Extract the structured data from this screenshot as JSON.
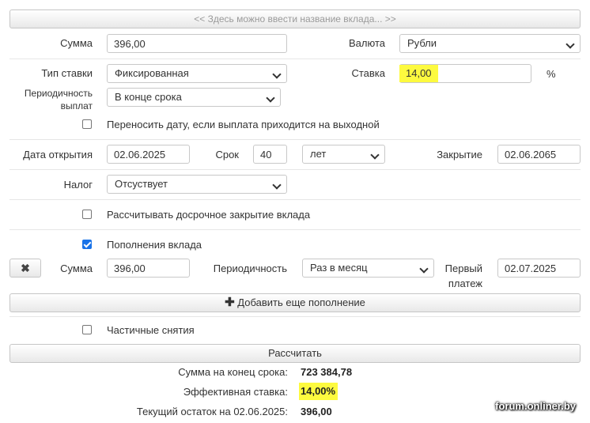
{
  "deposit_name_placeholder": "<< Здесь можно ввести название вклада... >>",
  "amount": {
    "label": "Сумма",
    "value": "396,00"
  },
  "currency": {
    "label": "Валюта",
    "selected": "Рубли"
  },
  "rate_type": {
    "label": "Тип ставки",
    "selected": "Фиксированная"
  },
  "rate": {
    "label": "Ставка",
    "value": "14,00",
    "unit": "%"
  },
  "payout_period": {
    "label_line1": "Периодичность",
    "label_line2": "выплат",
    "selected": "В конце срока"
  },
  "move_date": {
    "label": "Переносить дату, если выплата приходится на выходной",
    "checked": false
  },
  "open_date": {
    "label": "Дата открытия",
    "value": "02.06.2025"
  },
  "term": {
    "label": "Срок",
    "value": "40",
    "unit_selected": "лет"
  },
  "close_date": {
    "label": "Закрытие",
    "value": "02.06.2065"
  },
  "tax": {
    "label": "Налог",
    "selected": "Отсуствует"
  },
  "early_close": {
    "label": "Рассчитывать досрочное закрытие вклада",
    "checked": false
  },
  "replenishments": {
    "label": "Пополнения вклада",
    "checked": true,
    "item": {
      "remove_icon": "close-x-icon",
      "amount_label": "Сумма",
      "amount_value": "396,00",
      "period_label": "Периодичность",
      "period_selected": "Раз в месяц",
      "first_label_line1": "Первый",
      "first_label_line2": "платеж",
      "first_value": "02.07.2025"
    },
    "add_button": "Добавить еще пополнение"
  },
  "partial_withdrawals": {
    "label": "Частичные снятия",
    "checked": false
  },
  "calculate_button": "Рассчитать",
  "results": {
    "end_sum_label": "Сумма на конец срока:",
    "end_sum_value": "723 384,78",
    "effective_rate_label": "Эффективная ставка:",
    "effective_rate_value": "14,00%",
    "balance_label": "Текущий остаток на 02.06.2025:",
    "balance_value": "396,00"
  },
  "watermark": "forum.onliner.by",
  "colors": {
    "highlight": "#fdfa3f",
    "checkbox_checked": "#1a73e8"
  }
}
